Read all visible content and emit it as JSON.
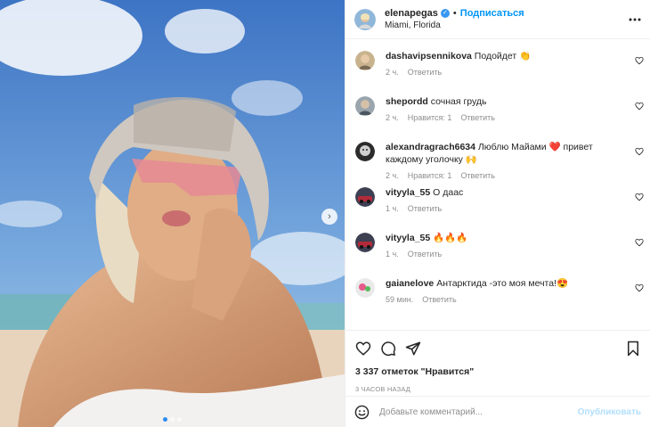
{
  "header": {
    "username": "elenapegas",
    "separator": "•",
    "follow_label": "Подписаться",
    "location": "Miami, Florida",
    "more_icon": "more-horizontal-icon"
  },
  "media": {
    "next_icon": "›",
    "dots": 3,
    "active_dot": 0
  },
  "comments": [
    {
      "user": "dashavipsennikova",
      "text": "Подойдет 👏",
      "time": "2 ч.",
      "likes": "",
      "reply": "Ответить"
    },
    {
      "user": "shepordd",
      "text": "сочная грудь",
      "time": "2 ч.",
      "likes": "Нравится: 1",
      "reply": "Ответить"
    },
    {
      "user": "alexandragrach6634",
      "text": "Люблю Майами ❤️ привет каждому уголочку 🙌",
      "time": "2 ч.",
      "likes": "Нравится: 1",
      "reply": "Ответить"
    },
    {
      "user": "vityyla_55",
      "text": "О даас",
      "time": "1 ч.",
      "likes": "",
      "reply": "Ответить"
    },
    {
      "user": "vityyla_55",
      "text": "🔥🔥🔥",
      "time": "1 ч.",
      "likes": "",
      "reply": "Ответить"
    },
    {
      "user": "gaianelove",
      "text": "Антарктида -это моя мечта!😍",
      "time": "59 мин.",
      "likes": "",
      "reply": "Ответить"
    }
  ],
  "actions": {
    "likes": "3 337 отметок \"Нравится\"",
    "time_ago": "3 ЧАСОВ НАЗАД"
  },
  "add_comment": {
    "placeholder": "Добавьте комментарий...",
    "publish_label": "Опубликовать"
  },
  "colors": {
    "accent": "#0095f6",
    "publish_disabled": "#b2dffc",
    "muted": "#8e8e8e",
    "border": "#efefef"
  }
}
